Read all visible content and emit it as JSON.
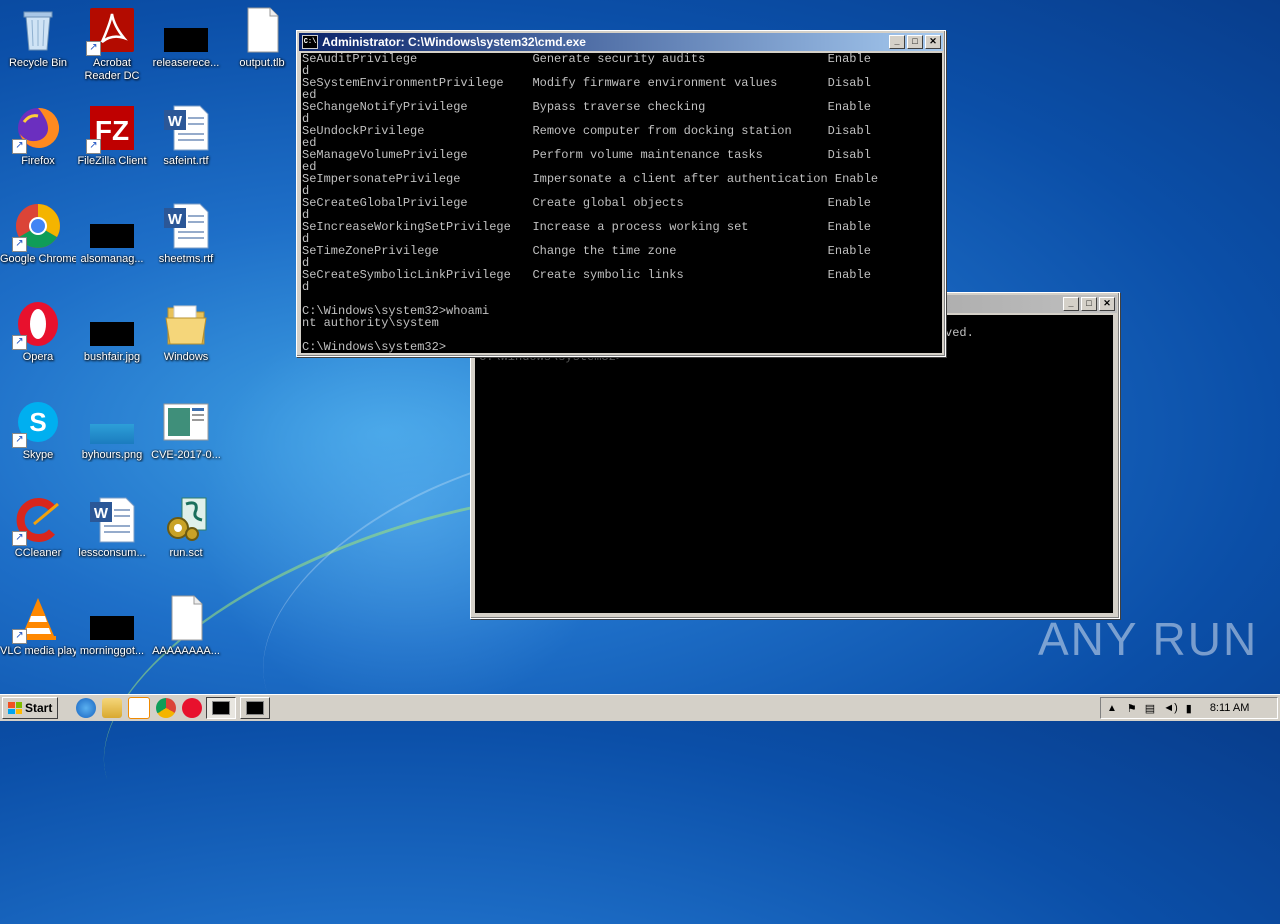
{
  "desktop": {
    "icons": [
      {
        "label": "Recycle Bin",
        "icon": "recycle-bin-icon"
      },
      {
        "label": "Acrobat Reader DC",
        "icon": "acrobat-icon"
      },
      {
        "label": "releaserece...",
        "icon": "redacted-file-icon"
      },
      {
        "label": "output.tlb",
        "icon": "blank-file-icon"
      },
      {
        "label": "Firefox",
        "icon": "firefox-icon"
      },
      {
        "label": "FileZilla Client",
        "icon": "filezilla-icon"
      },
      {
        "label": "safeint.rtf",
        "icon": "word-doc-icon"
      },
      {
        "label": "Google Chrome",
        "icon": "chrome-icon"
      },
      {
        "label": "alsomanag...",
        "icon": "redacted-file-icon"
      },
      {
        "label": "sheetms.rtf",
        "icon": "word-doc-icon"
      },
      {
        "label": "Opera",
        "icon": "opera-icon"
      },
      {
        "label": "bushfair.jpg",
        "icon": "redacted-image-icon"
      },
      {
        "label": "Windows",
        "icon": "folder-icon"
      },
      {
        "label": "Skype",
        "icon": "skype-icon"
      },
      {
        "label": "byhours.png",
        "icon": "image-file-icon"
      },
      {
        "label": "CVE-2017-0...",
        "icon": "image-preview-icon"
      },
      {
        "label": "CCleaner",
        "icon": "ccleaner-icon"
      },
      {
        "label": "lessconsum...",
        "icon": "word-doc-icon"
      },
      {
        "label": "run.sct",
        "icon": "script-gear-icon"
      },
      {
        "label": "VLC media player",
        "icon": "vlc-icon"
      },
      {
        "label": "morninggot...",
        "icon": "redacted-file-icon"
      },
      {
        "label": "AAAAAAAA...",
        "icon": "blank-file-icon"
      }
    ]
  },
  "cmd_window": {
    "title": "Administrator: C:\\Windows\\system32\\cmd.exe",
    "lines": [
      "SeAuditPrivilege                Generate security audits                 Enable",
      "d",
      "SeSystemEnvironmentPrivilege    Modify firmware environment values       Disabl",
      "ed",
      "SeChangeNotifyPrivilege         Bypass traverse checking                 Enable",
      "d",
      "SeUndockPrivilege               Remove computer from docking station     Disabl",
      "ed",
      "SeManageVolumePrivilege         Perform volume maintenance tasks         Disabl",
      "ed",
      "SeImpersonatePrivilege          Impersonate a client after authentication Enable",
      "d",
      "SeCreateGlobalPrivilege         Create global objects                    Enable",
      "d",
      "SeIncreaseWorkingSetPrivilege   Increase a process working set           Enable",
      "d",
      "SeTimeZonePrivilege             Change the time zone                     Enable",
      "d",
      "SeCreateSymbolicLinkPrivilege   Create symbolic links                    Enable",
      "d",
      "",
      "C:\\Windows\\system32>whoami",
      "nt authority\\system",
      "",
      "C:\\Windows\\system32>"
    ]
  },
  "back_window": {
    "visible_text": "ved.",
    "partial_line": "C:\\Windows\\system32>"
  },
  "taskbar": {
    "start_label": "Start",
    "clock": "8:11 AM"
  },
  "watermark": "ANY RUN",
  "colors": {
    "titlebar_active": "#0a246a",
    "console_bg": "#000000",
    "console_fg": "#c0c0c0"
  }
}
